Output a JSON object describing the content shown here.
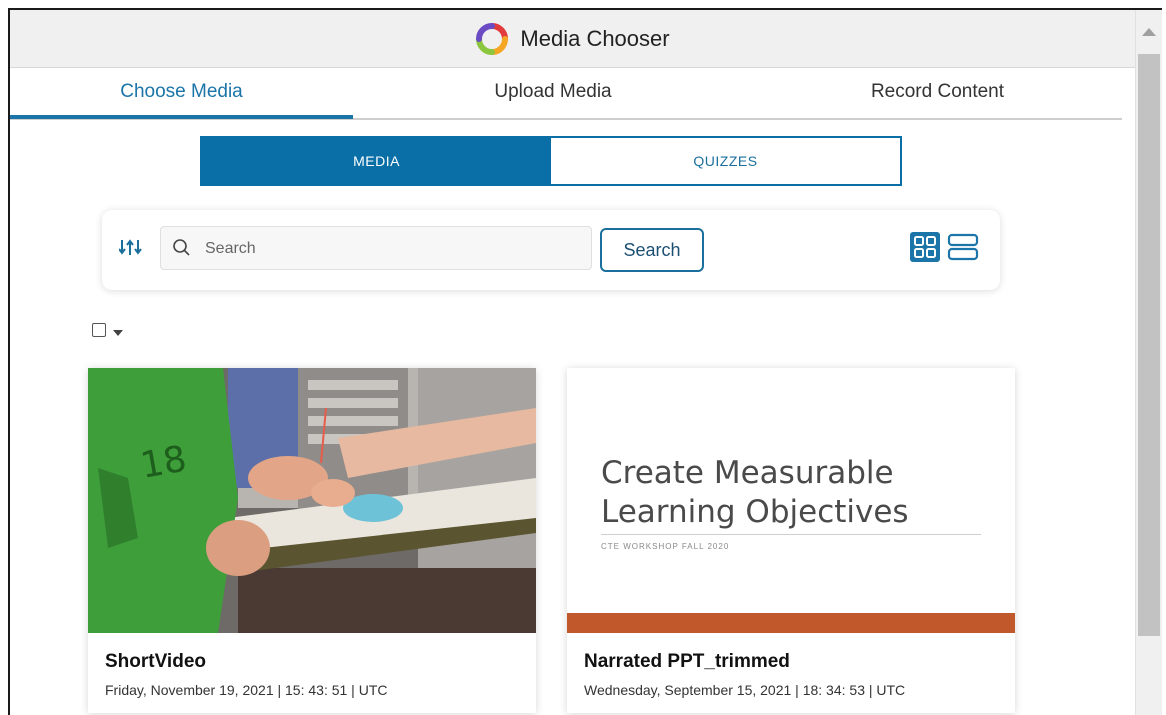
{
  "header": {
    "title": "Media Chooser",
    "logo_icon": "colorful-swirl-logo"
  },
  "tabs": [
    {
      "label": "Choose Media",
      "active": true
    },
    {
      "label": "Upload Media",
      "active": false
    },
    {
      "label": "Record Content",
      "active": false
    }
  ],
  "segmented": {
    "media_label": "MEDIA",
    "quizzes_label": "QUIZZES",
    "selected": "MEDIA"
  },
  "search": {
    "placeholder": "Search",
    "button_label": "Search",
    "sort_icon": "sort-icon",
    "view": "grid"
  },
  "cards": [
    {
      "name": "ShortVideo",
      "date": "Friday, November 19, 2021 | 15: 43: 51 | UTC",
      "thumbnail": "video-still-clinical"
    },
    {
      "name": "Narrated PPT_trimmed",
      "date": "Wednesday, September 15, 2021 | 18: 34: 53 | UTC",
      "thumbnail": "slide",
      "slide": {
        "title_line1": "Create Measurable",
        "title_line2": "Learning Objectives",
        "subtitle": "CTE WORKSHOP FALL 2020"
      }
    }
  ],
  "colors": {
    "accent": "#0a6fa6",
    "slide_bar": "#c0582b"
  }
}
